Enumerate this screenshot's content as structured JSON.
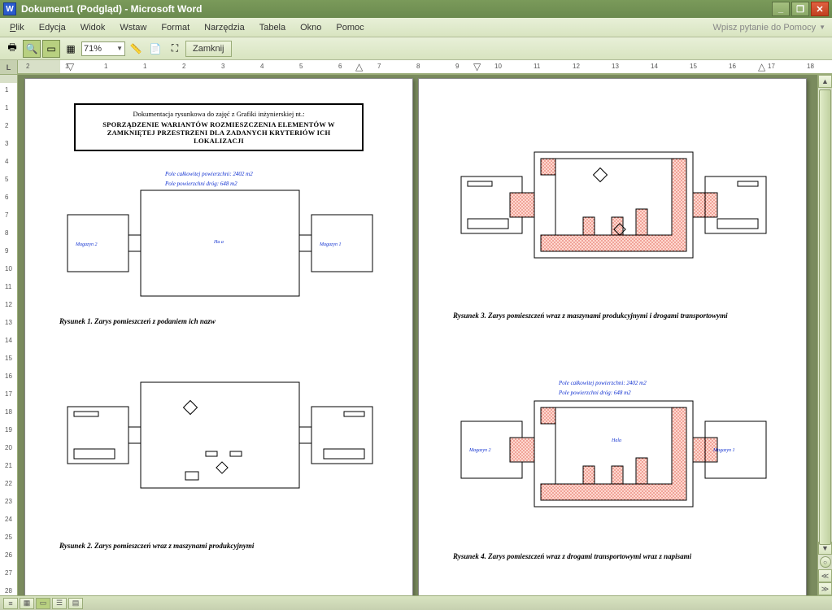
{
  "title": "Dokument1 (Podgląd) - Microsoft Word",
  "app_icon": "W",
  "menus": {
    "plik": "Plik",
    "edycja": "Edycja",
    "widok": "Widok",
    "wstaw": "Wstaw",
    "format": "Format",
    "narzedzia": "Narzędzia",
    "tabela": "Tabela",
    "okno": "Okno",
    "pomoc": "Pomoc"
  },
  "help_placeholder": "Wpisz pytanie do Pomocy",
  "zoom": "71%",
  "close_label": "Zamknij",
  "ruler_corner": "L",
  "h_ruler_labels": [
    "2",
    "1",
    "1",
    "1",
    "2",
    "3",
    "4",
    "5",
    "6",
    "7",
    "8",
    "9",
    "10",
    "11",
    "12",
    "13",
    "14",
    "15",
    "16",
    "17",
    "18"
  ],
  "v_ruler_labels": [
    "1",
    "1",
    "2",
    "3",
    "4",
    "5",
    "6",
    "7",
    "8",
    "9",
    "10",
    "11",
    "12",
    "13",
    "14",
    "15",
    "16",
    "17",
    "18",
    "19",
    "20",
    "21",
    "22",
    "23",
    "24",
    "25",
    "26",
    "27",
    "28"
  ],
  "page1": {
    "header_line1": "Dokumentacja rysunkowa do zajęć z Grafiki inżynierskiej nt.:",
    "header_line2": "SPORZĄDZENIE WARIANTÓW ROZMIESZCZENIA ELEMENTÓW W",
    "header_line3": "ZAMKNIĘTEJ PRZESTRZENI DLA ZADANYCH KRYTERIÓW ICH LOKALIZACJI",
    "d1": {
      "area_total": "Pole całkowitej powierzchni: 2402 m2",
      "area_road": "Pole powierzchni dróg: 648 m2",
      "hala": "Ha a",
      "mag1": "Magazyn 1",
      "mag2": "Magazyn 2"
    },
    "caption1": "Rysunek 1. Zarys pomieszczeń z podaniem ich nazw",
    "caption2": "Rysunek 2. Zarys pomieszczeń wraz z maszynami produkcyjnymi"
  },
  "page2": {
    "caption3": "Rysunek 3. Zarys pomieszczeń wraz z maszynami produkcyjnymi i drogami transportowymi",
    "d4": {
      "area_total": "Pole całkowitej powierzchni: 2402 m2",
      "area_road": "Pole powierzchni dróg: 648 m2",
      "hala": "Hala",
      "mag1": "Magazyn 1",
      "mag2": "Magazyn 2"
    },
    "caption4": "Rysunek 4. Zarys pomieszczeń wraz z drogami transportowymi wraz z napisami"
  }
}
